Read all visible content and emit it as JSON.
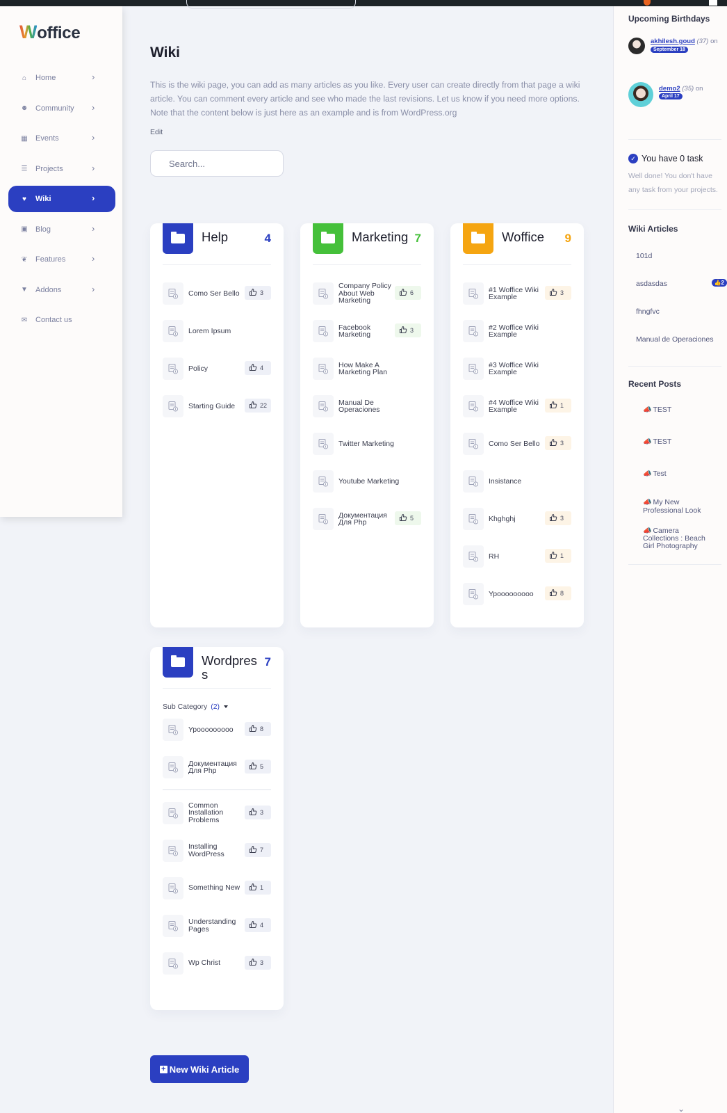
{
  "brand": {
    "logo_initial": "W",
    "logo_rest": "office"
  },
  "colors": {
    "accent": "#2b3fc1",
    "help": "#2b3fc1",
    "marketing": "#45c03a",
    "woffice": "#f5a511",
    "wordpress": "#2b3fc1"
  },
  "sidebar": {
    "items": [
      {
        "label": "Home",
        "icon": "home-icon",
        "active": false
      },
      {
        "label": "Community",
        "icon": "users-icon",
        "active": false
      },
      {
        "label": "Events",
        "icon": "calendar-icon",
        "active": false
      },
      {
        "label": "Projects",
        "icon": "tasks-icon",
        "active": false
      },
      {
        "label": "Wiki",
        "icon": "wiki-icon",
        "active": true
      },
      {
        "label": "Blog",
        "icon": "blog-icon",
        "active": false
      },
      {
        "label": "Features",
        "icon": "feather-icon",
        "active": false
      },
      {
        "label": "Addons",
        "icon": "plug-icon",
        "active": false
      },
      {
        "label": "Contact us",
        "icon": "envelope-icon",
        "active": false
      }
    ]
  },
  "main": {
    "title": "Wiki",
    "intro": "This is the wiki page, you can add as many articles as you like. Every user can create directly from that page a wiki article. You can comment every article and see who made the last revisions. Let us know if you need more options. Note that the content below is just here as an example and is from WordPress.org",
    "edit_label": "Edit",
    "search_placeholder": "Search...",
    "new_article_label": "New Wiki Article",
    "categories": [
      {
        "name": "Help",
        "count": "4",
        "color": "#2b3fc1",
        "like_bg": "#eef0f7",
        "articles": [
          {
            "title": "Como Ser Bello",
            "likes": "3"
          },
          {
            "title": "Lorem Ipsum",
            "likes": null
          },
          {
            "title": "Policy",
            "likes": "4"
          },
          {
            "title": "Starting Guide",
            "likes": "22"
          }
        ]
      },
      {
        "name": "Marketing",
        "count": "7",
        "color": "#45c03a",
        "like_bg": "#eef8ec",
        "articles": [
          {
            "title": "Company Policy About Web Marketing",
            "likes": "6"
          },
          {
            "title": "Facebook Marketing",
            "likes": "3"
          },
          {
            "title": "How Make A Marketing Plan",
            "likes": null
          },
          {
            "title": "Manual De Operaciones",
            "likes": null
          },
          {
            "title": "Twitter Marketing",
            "likes": null
          },
          {
            "title": "Youtube Marketing",
            "likes": null
          },
          {
            "title": "Документация Для Php",
            "likes": "5"
          }
        ]
      },
      {
        "name": "Woffice",
        "count": "9",
        "color": "#f5a511",
        "like_bg": "#fdf4e6",
        "articles": [
          {
            "title": "#1 Woffice Wiki Example",
            "likes": "3"
          },
          {
            "title": "#2 Woffice Wiki Example",
            "likes": null
          },
          {
            "title": "#3 Woffice Wiki Example",
            "likes": null
          },
          {
            "title": "#4 Woffice Wiki Example",
            "likes": "1"
          },
          {
            "title": "Como Ser Bello",
            "likes": "3"
          },
          {
            "title": "Insistance",
            "likes": null
          },
          {
            "title": "Khghghj",
            "likes": "3"
          },
          {
            "title": "RH",
            "likes": "1"
          },
          {
            "title": "Ypooooooooo",
            "likes": "8"
          }
        ]
      },
      {
        "name": "Wordpress",
        "count": "7",
        "color": "#2b3fc1",
        "like_bg": "#eef0f7",
        "subcategory": {
          "label": "Sub Category",
          "count": "(2)",
          "articles": [
            {
              "title": "Ypooooooooo",
              "likes": "8"
            },
            {
              "title": "Документация Для Php",
              "likes": "5"
            }
          ]
        },
        "articles": [
          {
            "title": "Common Installation Problems",
            "likes": "3"
          },
          {
            "title": "Installing WordPress",
            "likes": "7"
          },
          {
            "title": "Something New",
            "likes": "1"
          },
          {
            "title": "Understanding Pages",
            "likes": "4"
          },
          {
            "title": "Wp Christ",
            "likes": "3"
          }
        ]
      }
    ]
  },
  "right": {
    "birthdays_title": "Upcoming Birthdays",
    "birthdays": [
      {
        "name": "akhilesh.goud",
        "age": "(37)",
        "on": "on",
        "date": "September 18"
      },
      {
        "name": "demo2",
        "age": "(35)",
        "on": "on",
        "date": "April 17"
      }
    ],
    "task_title": "You have 0 task",
    "task_text": "Well done! You don't have any task from your projects.",
    "wiki_title": "Wiki Articles",
    "wiki_articles": [
      {
        "title": "101d",
        "likes": null
      },
      {
        "title": "asdasdas",
        "likes": "2"
      },
      {
        "title": "fhngfvc",
        "likes": null
      },
      {
        "title": "Manual de Operaciones",
        "likes": null
      }
    ],
    "posts_title": "Recent Posts",
    "posts": [
      "TEST",
      "TEST",
      "Test",
      "My New Professional Look",
      "Camera Collections : Beach Girl Photography"
    ]
  }
}
